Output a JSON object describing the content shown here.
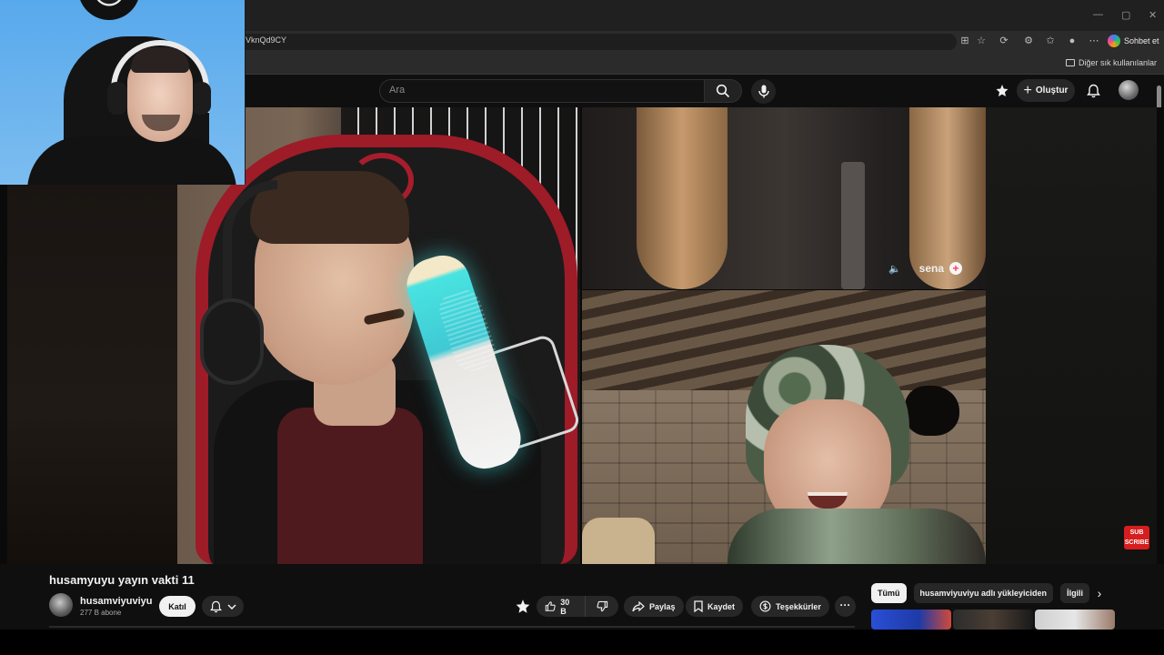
{
  "browser": {
    "url": "VknQd9CY",
    "copilot_label": "Sohbet et",
    "bookmarks_folder": "Diğer sık kullanılanlar",
    "window_controls": [
      "—",
      "▢",
      "✕"
    ]
  },
  "header": {
    "search_placeholder": "Ara",
    "create_label": "Oluştur",
    "icons": [
      "search-icon",
      "mic-icon",
      "premium-sparkle-icon",
      "plus-icon",
      "bell-icon"
    ]
  },
  "video": {
    "top_pane_user": "sena",
    "subscribe_badge": "SUB\nSCRIBE",
    "title": "husamyuyu yayın vakti 11"
  },
  "channel": {
    "name": "husamviyuviyu",
    "subscribers": "277 B abone",
    "join_label": "Katıl"
  },
  "actions": {
    "like_count": "30 B",
    "share_label": "Paylaş",
    "save_label": "Kaydet",
    "thanks_label": "Teşekkürler",
    "more_label": "···"
  },
  "related_chips": [
    {
      "label": "Tümü",
      "active": true
    },
    {
      "label": "husamviyuviyu adlı yükleyiciden",
      "active": false
    },
    {
      "label": "İlgili",
      "active": false
    }
  ],
  "colors": {
    "background": "#0f0f0f",
    "pill": "#272727",
    "accent_red": "#d61e1e",
    "text": "#f1f1f1"
  }
}
